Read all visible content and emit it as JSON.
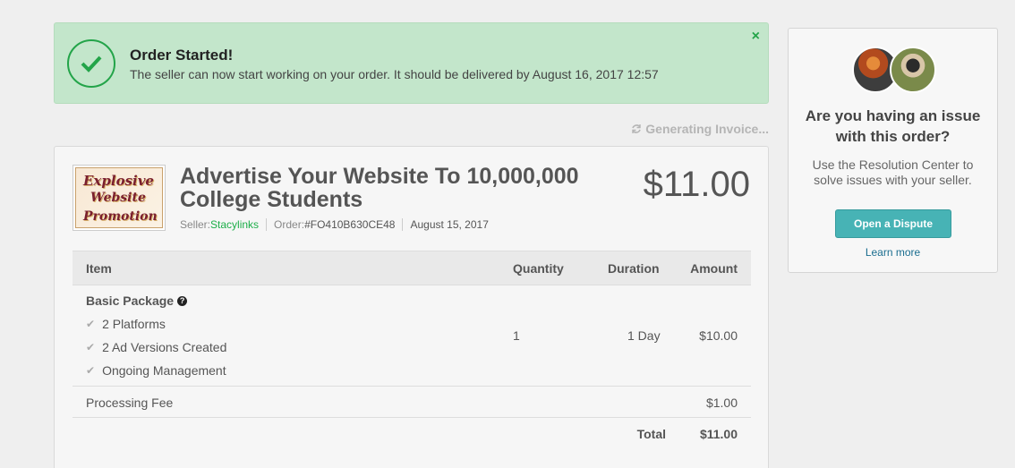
{
  "alert": {
    "title": "Order Started!",
    "message": "The seller can now start working on your order. It should be delivered by August 16, 2017 12:57",
    "close_label": "×"
  },
  "invoice_status": "Generating Invoice...",
  "order": {
    "title": "Advertise Your Website To 10,000,000 College Students",
    "seller_label": "Seller:",
    "seller_name": "Stacylinks",
    "order_label": "Order:",
    "order_id": "#FO410B630CE48",
    "date": "August 15, 2017",
    "price": "$11.00",
    "thumbnail_text": [
      "Explosive",
      "Website",
      "Promotion"
    ]
  },
  "table": {
    "headers": {
      "item": "Item",
      "quantity": "Quantity",
      "duration": "Duration",
      "amount": "Amount"
    },
    "package": {
      "name": "Basic Package",
      "features": [
        "2 Platforms",
        "2 Ad Versions Created",
        "Ongoing Management"
      ],
      "quantity": "1",
      "duration": "1 Day",
      "amount": "$10.00"
    },
    "fee": {
      "label": "Processing Fee",
      "amount": "$1.00"
    },
    "total": {
      "label": "Total",
      "amount": "$11.00"
    }
  },
  "side_panel": {
    "question_line1": "Are you having an issue",
    "question_line2": "with this order?",
    "desc_line1": "Use the Resolution Center to",
    "desc_line2": "solve issues with your seller.",
    "dispute_button": "Open a Dispute",
    "learn_more": "Learn more"
  },
  "colors": {
    "success_green": "#23a449",
    "alert_bg": "#c3e6cb",
    "button_teal": "#47b3b5",
    "link_green": "#1dae49"
  },
  "icons": [
    "check-circle-icon",
    "close-icon",
    "refresh-icon",
    "question-icon",
    "checkmark-icon"
  ]
}
